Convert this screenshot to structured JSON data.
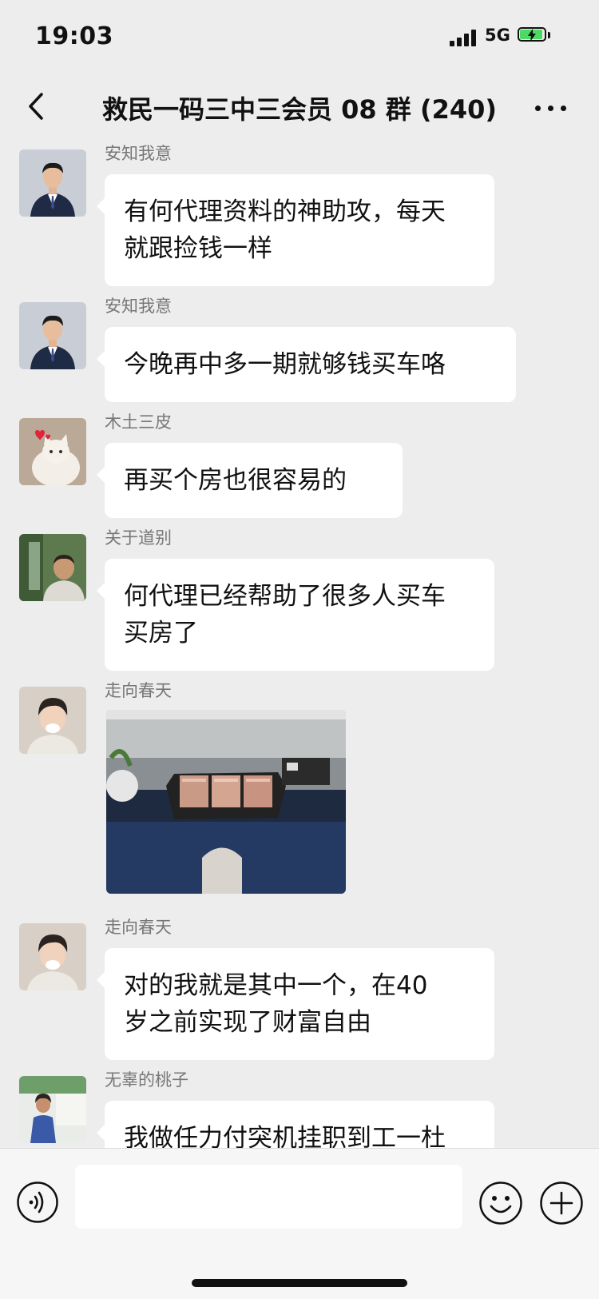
{
  "status_bar": {
    "time": "19:03",
    "network": "5G"
  },
  "nav": {
    "title": "救民一码三中三会员 08 群 (240)"
  },
  "messages": [
    {
      "sender": "安知我意",
      "lines": [
        "有何代理资料的神助攻，每天",
        "就跟捡钱一样"
      ]
    },
    {
      "sender": "安知我意",
      "lines": [
        "今晚再中多一期就够钱买车咯"
      ]
    },
    {
      "sender": "木土三皮",
      "lines": [
        "再买个房也很容易的"
      ]
    },
    {
      "sender": "关于道别",
      "lines": [
        "何代理已经帮助了很多人买车",
        "买房了"
      ]
    },
    {
      "sender": "走向春天",
      "image": "photo-of-cash-bundles"
    },
    {
      "sender": "走向春天",
      "lines": [
        "对的我就是其中一个，在40",
        "岁之前实现了财富自由"
      ]
    },
    {
      "sender": "无辜的桃子",
      "lines": [
        "我做任力付突机挂职到工一杜"
      ]
    }
  ],
  "input_bar": {
    "voice_icon": "voice-icon",
    "emoji_icon": "emoji-icon",
    "plus_icon": "plus-icon"
  },
  "colors": {
    "background": "#ededed",
    "bubble": "#ffffff",
    "battery": "#4cd964"
  }
}
